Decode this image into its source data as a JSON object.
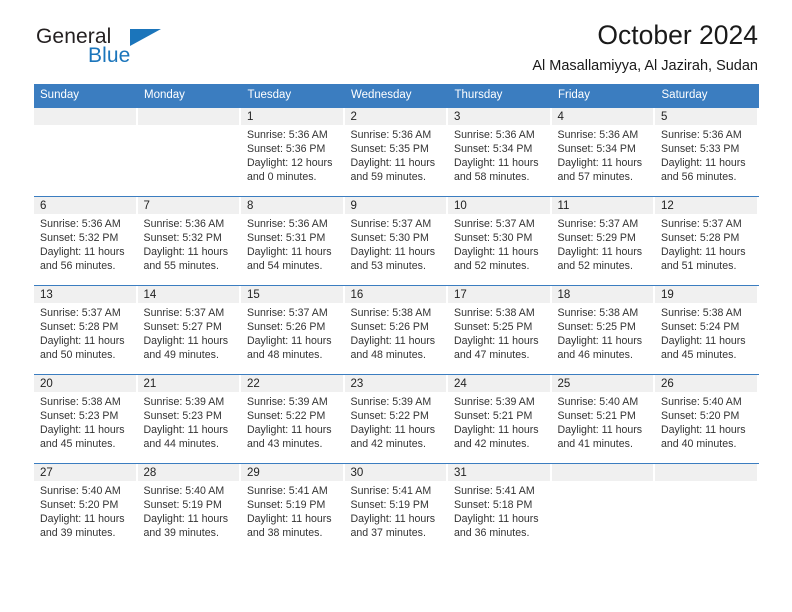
{
  "brand": {
    "name_top": "General",
    "name_bottom": "Blue",
    "accent_color": "#1b75bb"
  },
  "header": {
    "title": "October 2024",
    "subtitle": "Al Masallamiyya, Al Jazirah, Sudan"
  },
  "calendar": {
    "header_color": "#3b7dc0",
    "daynum_band_color": "#f0f0f0",
    "weekdays": [
      "Sunday",
      "Monday",
      "Tuesday",
      "Wednesday",
      "Thursday",
      "Friday",
      "Saturday"
    ],
    "weeks": [
      [
        {
          "day": "",
          "lines": []
        },
        {
          "day": "",
          "lines": []
        },
        {
          "day": "1",
          "lines": [
            "Sunrise: 5:36 AM",
            "Sunset: 5:36 PM",
            "Daylight: 12 hours and 0 minutes."
          ]
        },
        {
          "day": "2",
          "lines": [
            "Sunrise: 5:36 AM",
            "Sunset: 5:35 PM",
            "Daylight: 11 hours and 59 minutes."
          ]
        },
        {
          "day": "3",
          "lines": [
            "Sunrise: 5:36 AM",
            "Sunset: 5:34 PM",
            "Daylight: 11 hours and 58 minutes."
          ]
        },
        {
          "day": "4",
          "lines": [
            "Sunrise: 5:36 AM",
            "Sunset: 5:34 PM",
            "Daylight: 11 hours and 57 minutes."
          ]
        },
        {
          "day": "5",
          "lines": [
            "Sunrise: 5:36 AM",
            "Sunset: 5:33 PM",
            "Daylight: 11 hours and 56 minutes."
          ]
        }
      ],
      [
        {
          "day": "6",
          "lines": [
            "Sunrise: 5:36 AM",
            "Sunset: 5:32 PM",
            "Daylight: 11 hours and 56 minutes."
          ]
        },
        {
          "day": "7",
          "lines": [
            "Sunrise: 5:36 AM",
            "Sunset: 5:32 PM",
            "Daylight: 11 hours and 55 minutes."
          ]
        },
        {
          "day": "8",
          "lines": [
            "Sunrise: 5:36 AM",
            "Sunset: 5:31 PM",
            "Daylight: 11 hours and 54 minutes."
          ]
        },
        {
          "day": "9",
          "lines": [
            "Sunrise: 5:37 AM",
            "Sunset: 5:30 PM",
            "Daylight: 11 hours and 53 minutes."
          ]
        },
        {
          "day": "10",
          "lines": [
            "Sunrise: 5:37 AM",
            "Sunset: 5:30 PM",
            "Daylight: 11 hours and 52 minutes."
          ]
        },
        {
          "day": "11",
          "lines": [
            "Sunrise: 5:37 AM",
            "Sunset: 5:29 PM",
            "Daylight: 11 hours and 52 minutes."
          ]
        },
        {
          "day": "12",
          "lines": [
            "Sunrise: 5:37 AM",
            "Sunset: 5:28 PM",
            "Daylight: 11 hours and 51 minutes."
          ]
        }
      ],
      [
        {
          "day": "13",
          "lines": [
            "Sunrise: 5:37 AM",
            "Sunset: 5:28 PM",
            "Daylight: 11 hours and 50 minutes."
          ]
        },
        {
          "day": "14",
          "lines": [
            "Sunrise: 5:37 AM",
            "Sunset: 5:27 PM",
            "Daylight: 11 hours and 49 minutes."
          ]
        },
        {
          "day": "15",
          "lines": [
            "Sunrise: 5:37 AM",
            "Sunset: 5:26 PM",
            "Daylight: 11 hours and 48 minutes."
          ]
        },
        {
          "day": "16",
          "lines": [
            "Sunrise: 5:38 AM",
            "Sunset: 5:26 PM",
            "Daylight: 11 hours and 48 minutes."
          ]
        },
        {
          "day": "17",
          "lines": [
            "Sunrise: 5:38 AM",
            "Sunset: 5:25 PM",
            "Daylight: 11 hours and 47 minutes."
          ]
        },
        {
          "day": "18",
          "lines": [
            "Sunrise: 5:38 AM",
            "Sunset: 5:25 PM",
            "Daylight: 11 hours and 46 minutes."
          ]
        },
        {
          "day": "19",
          "lines": [
            "Sunrise: 5:38 AM",
            "Sunset: 5:24 PM",
            "Daylight: 11 hours and 45 minutes."
          ]
        }
      ],
      [
        {
          "day": "20",
          "lines": [
            "Sunrise: 5:38 AM",
            "Sunset: 5:23 PM",
            "Daylight: 11 hours and 45 minutes."
          ]
        },
        {
          "day": "21",
          "lines": [
            "Sunrise: 5:39 AM",
            "Sunset: 5:23 PM",
            "Daylight: 11 hours and 44 minutes."
          ]
        },
        {
          "day": "22",
          "lines": [
            "Sunrise: 5:39 AM",
            "Sunset: 5:22 PM",
            "Daylight: 11 hours and 43 minutes."
          ]
        },
        {
          "day": "23",
          "lines": [
            "Sunrise: 5:39 AM",
            "Sunset: 5:22 PM",
            "Daylight: 11 hours and 42 minutes."
          ]
        },
        {
          "day": "24",
          "lines": [
            "Sunrise: 5:39 AM",
            "Sunset: 5:21 PM",
            "Daylight: 11 hours and 42 minutes."
          ]
        },
        {
          "day": "25",
          "lines": [
            "Sunrise: 5:40 AM",
            "Sunset: 5:21 PM",
            "Daylight: 11 hours and 41 minutes."
          ]
        },
        {
          "day": "26",
          "lines": [
            "Sunrise: 5:40 AM",
            "Sunset: 5:20 PM",
            "Daylight: 11 hours and 40 minutes."
          ]
        }
      ],
      [
        {
          "day": "27",
          "lines": [
            "Sunrise: 5:40 AM",
            "Sunset: 5:20 PM",
            "Daylight: 11 hours and 39 minutes."
          ]
        },
        {
          "day": "28",
          "lines": [
            "Sunrise: 5:40 AM",
            "Sunset: 5:19 PM",
            "Daylight: 11 hours and 39 minutes."
          ]
        },
        {
          "day": "29",
          "lines": [
            "Sunrise: 5:41 AM",
            "Sunset: 5:19 PM",
            "Daylight: 11 hours and 38 minutes."
          ]
        },
        {
          "day": "30",
          "lines": [
            "Sunrise: 5:41 AM",
            "Sunset: 5:19 PM",
            "Daylight: 11 hours and 37 minutes."
          ]
        },
        {
          "day": "31",
          "lines": [
            "Sunrise: 5:41 AM",
            "Sunset: 5:18 PM",
            "Daylight: 11 hours and 36 minutes."
          ]
        },
        {
          "day": "",
          "lines": []
        },
        {
          "day": "",
          "lines": []
        }
      ]
    ]
  }
}
